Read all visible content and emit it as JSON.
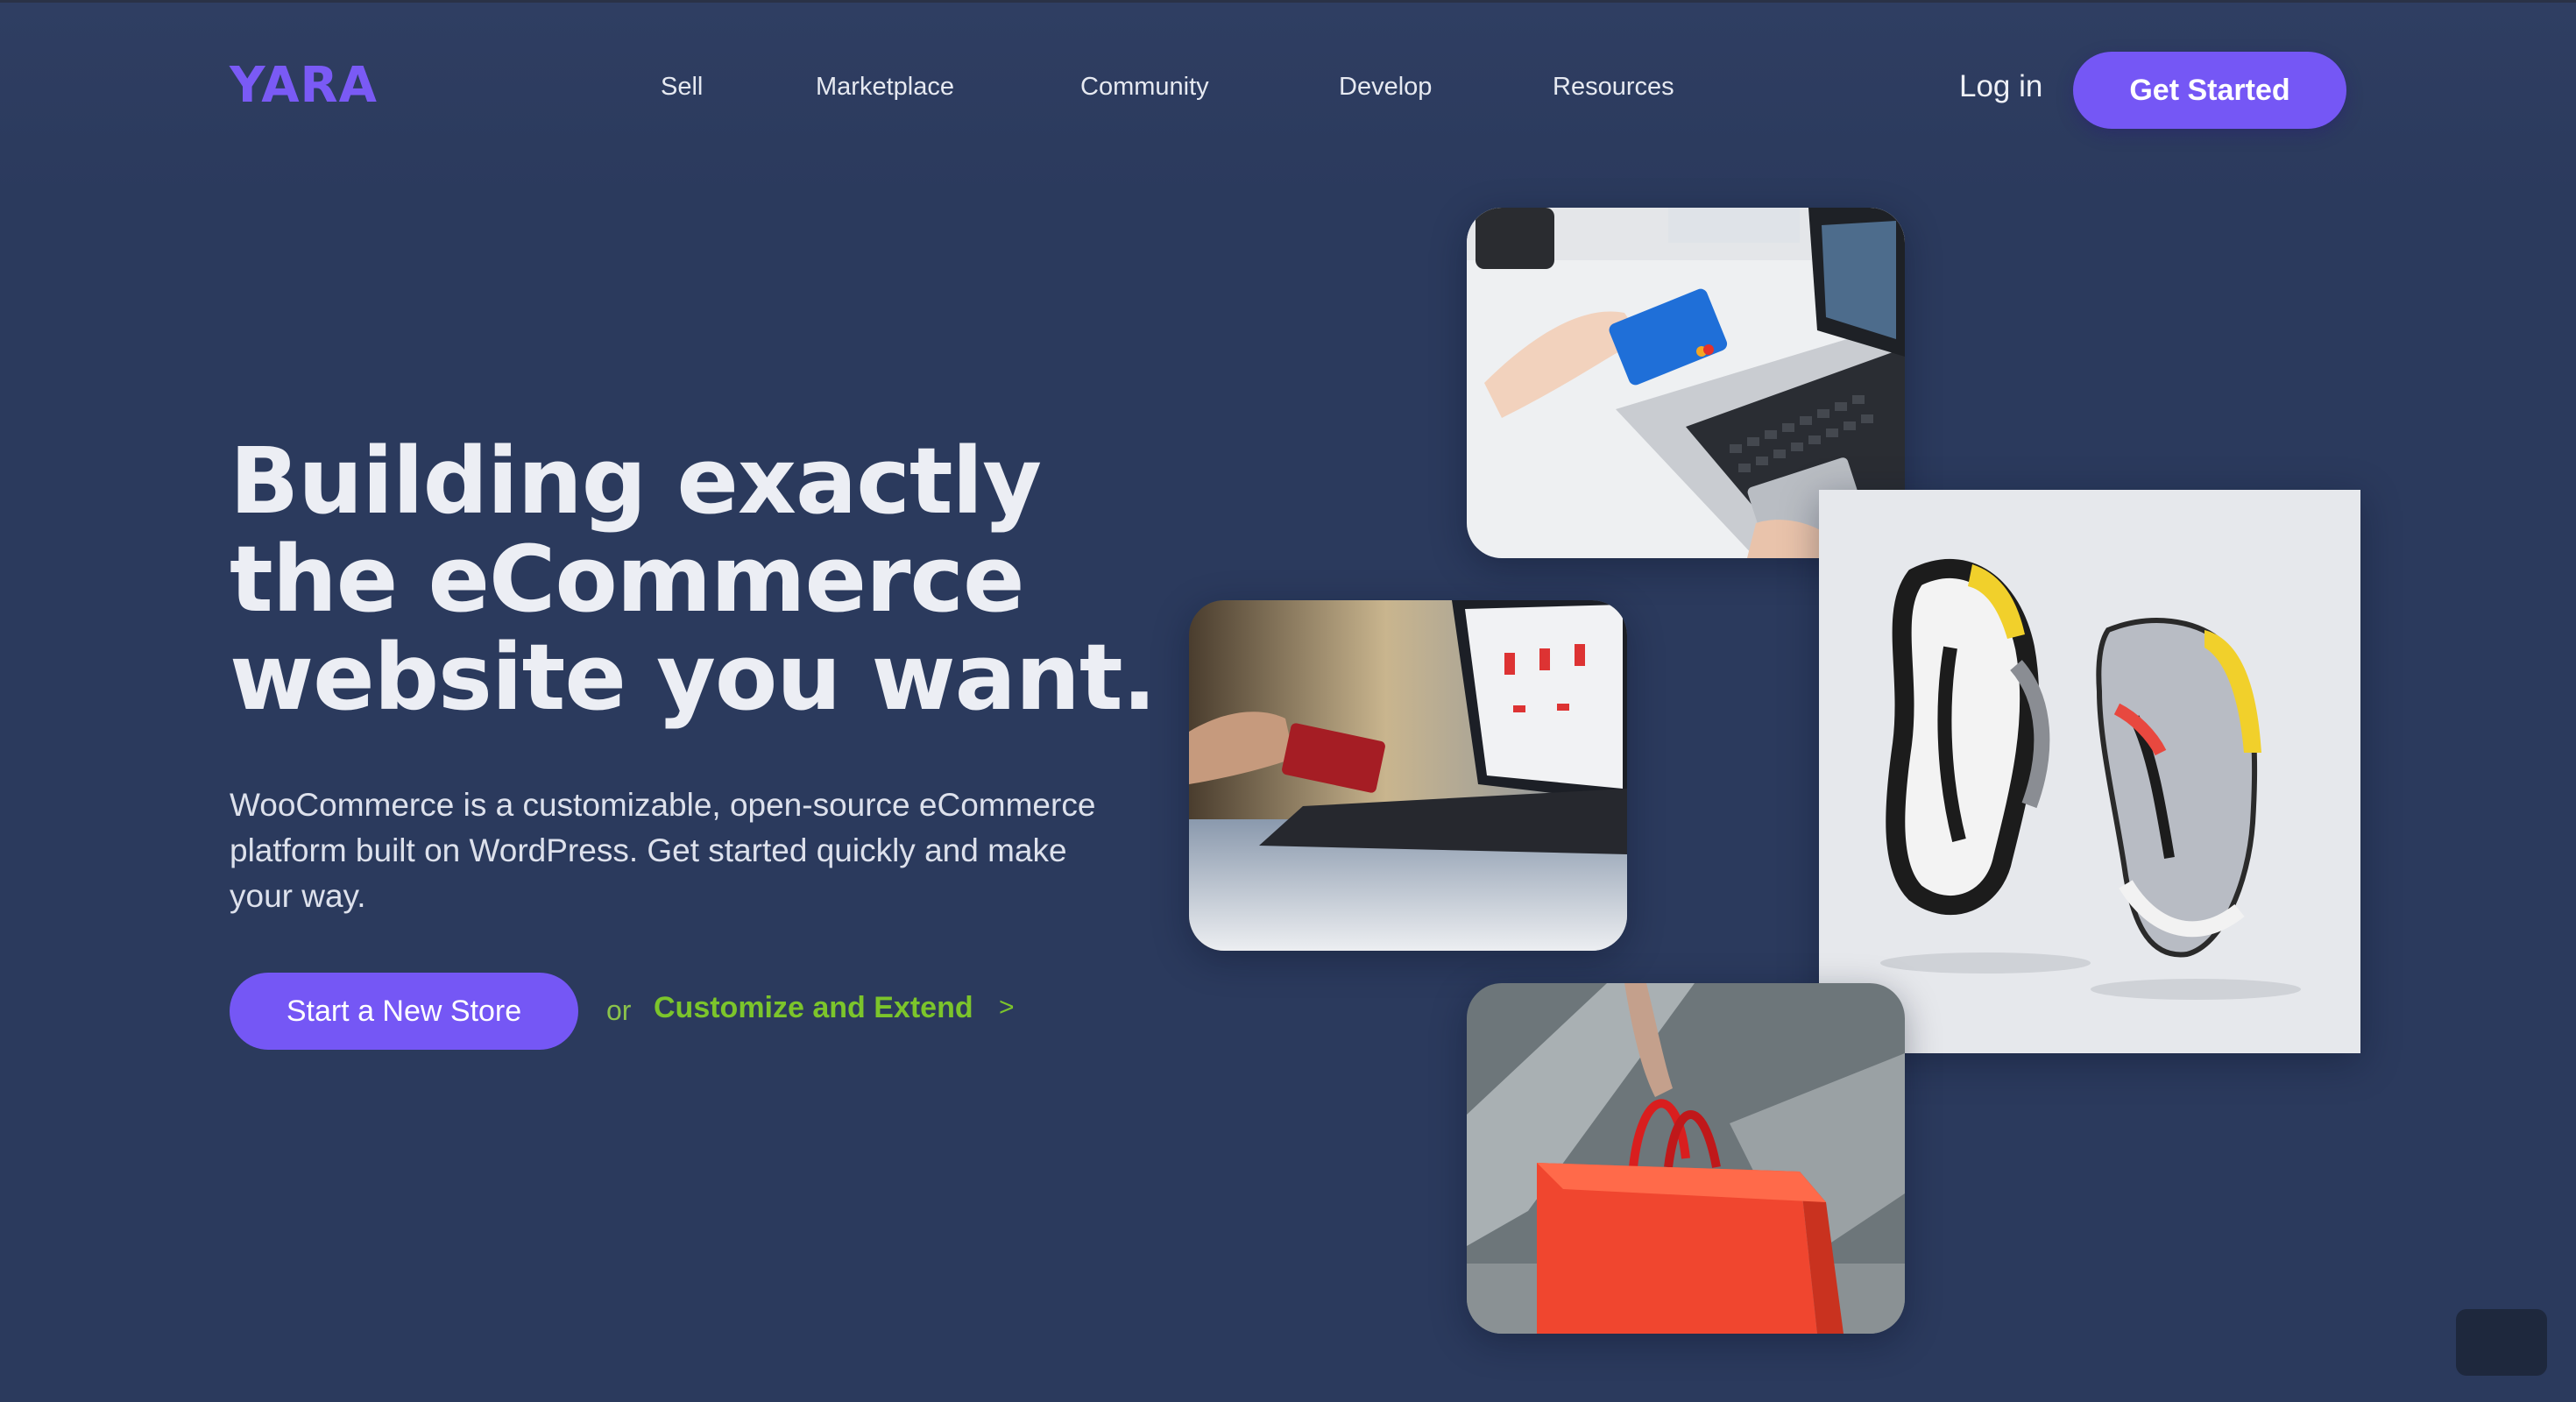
{
  "brand": {
    "name": "YARA",
    "color": "#7a5af5"
  },
  "nav": {
    "items": [
      {
        "label": "Sell"
      },
      {
        "label": "Marketplace"
      },
      {
        "label": "Community"
      },
      {
        "label": "Develop"
      },
      {
        "label": "Resources"
      }
    ],
    "login_label": "Log in",
    "cta_label": "Get Started"
  },
  "hero": {
    "headline_lines": [
      "Building exactly",
      "the eCommerce",
      "website you want."
    ],
    "subtext": "WooCommerce is a customizable, open-source eCommerce platform built on WordPress. Get started quickly and make your way.",
    "primary_button": "Start a New Store",
    "or_text": "or",
    "secondary_link": "Customize and Extend",
    "secondary_arrow": ">"
  },
  "images": [
    {
      "name": "credit-card-laptop-photo",
      "subject": "hands holding a blue credit card over a laptop keyboard"
    },
    {
      "name": "online-shopping-laptop-photo",
      "subject": "hand holding a red card in front of a laptop showing a shop"
    },
    {
      "name": "sneakers-photo",
      "subject": "pair of grey sneakers with yellow and red accents"
    },
    {
      "name": "shopping-bag-photo",
      "subject": "hand carrying a red shopping bag"
    }
  ],
  "theme_toggle": {
    "icon": "moon-icon"
  },
  "colors": {
    "background": "#2b3a5d",
    "accent": "#7557f5",
    "link_green": "#7cc52b",
    "text": "#eceef4"
  }
}
